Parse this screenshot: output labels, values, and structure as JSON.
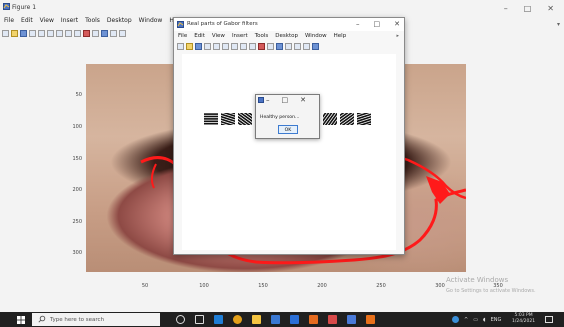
{
  "figure1": {
    "title": "Figure 1",
    "menu": [
      "File",
      "Edit",
      "View",
      "Insert",
      "Tools",
      "Desktop",
      "Window",
      "Help"
    ],
    "window_buttons": [
      "–",
      "□",
      "✕"
    ],
    "expand_glyph": "▾",
    "axes": {
      "y_ticks": [
        "50",
        "100",
        "150",
        "200",
        "250",
        "300"
      ],
      "x_ticks": [
        "50",
        "100",
        "150",
        "200",
        "250",
        "300",
        "350"
      ]
    }
  },
  "figure2": {
    "title": "Real parts of Gabor filters",
    "menu": [
      "File",
      "Edit",
      "View",
      "Insert",
      "Tools",
      "Desktop",
      "Window",
      "Help"
    ],
    "window_buttons": [
      "–",
      "□",
      "✕"
    ],
    "expand_glyph": "▸",
    "gabor_filter_count": 10
  },
  "dialog": {
    "window_buttons": [
      "–",
      "□",
      "✕"
    ],
    "message": "Healthy person...",
    "ok_label": "OK"
  },
  "watermark": {
    "line1": "Activate Windows",
    "line2": "Go to Settings to activate Windows."
  },
  "taskbar": {
    "search_placeholder": "Type here to search",
    "tray_lang": "ENG",
    "time": "5:03 PM",
    "date": "1/24/2021"
  },
  "colors": {
    "segmentation_outline": "#ff1a1a",
    "taskbar": "#202020",
    "dialog_ok_border": "#3d7bd0"
  }
}
